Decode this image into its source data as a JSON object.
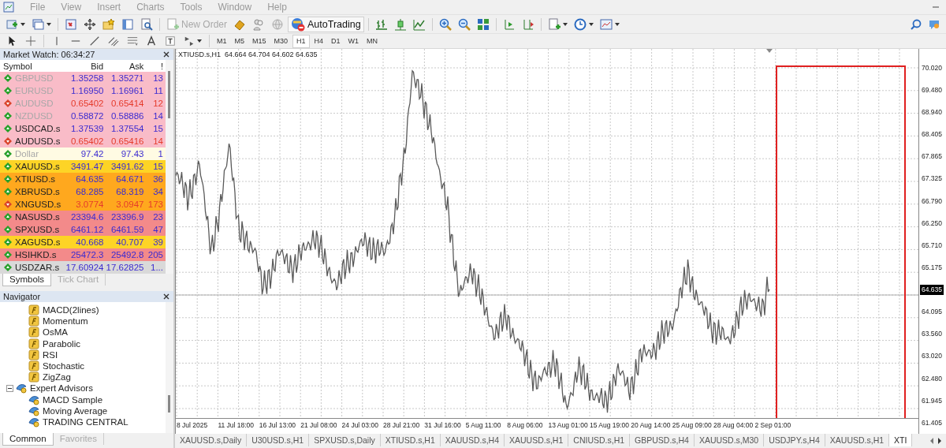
{
  "menu": [
    "File",
    "View",
    "Insert",
    "Charts",
    "Tools",
    "Window",
    "Help"
  ],
  "toolbar": {
    "new_order": {
      "label": "New Order",
      "disabled": true
    },
    "autotrading": {
      "label": "AutoTrading"
    }
  },
  "timeframes": [
    {
      "label": "M1",
      "selected": false
    },
    {
      "label": "M5",
      "selected": false
    },
    {
      "label": "M15",
      "selected": false
    },
    {
      "label": "M30",
      "selected": false
    },
    {
      "label": "H1",
      "selected": true
    },
    {
      "label": "H4",
      "selected": false
    },
    {
      "label": "D1",
      "selected": false
    },
    {
      "label": "W1",
      "selected": false
    },
    {
      "label": "MN",
      "selected": false
    }
  ],
  "market_watch": {
    "title": "Market Watch: 06:34:27",
    "columns": [
      "Symbol",
      "Bid",
      "Ask",
      "!"
    ],
    "rows": [
      {
        "symbol": "GBPUSD",
        "bid": "1.35258",
        "ask": "1.35271",
        "spread": "13",
        "down": false,
        "dimmed": true,
        "color": "#f9bcc8"
      },
      {
        "symbol": "EURUSD",
        "bid": "1.16950",
        "ask": "1.16961",
        "spread": "11",
        "down": false,
        "dimmed": true,
        "color": "#f9bcc8"
      },
      {
        "symbol": "AUDUSD",
        "bid": "0.65402",
        "ask": "0.65414",
        "spread": "12",
        "down": true,
        "dimmed": true,
        "color": "#f9bcc8"
      },
      {
        "symbol": "NZDUSD",
        "bid": "0.58872",
        "ask": "0.58886",
        "spread": "14",
        "down": false,
        "dimmed": true,
        "color": "#f9bcc8"
      },
      {
        "symbol": "USDCAD.s",
        "bid": "1.37539",
        "ask": "1.37554",
        "spread": "15",
        "down": false,
        "dimmed": false,
        "color": "#f9bcc8"
      },
      {
        "symbol": "AUDUSD.s",
        "bid": "0.65402",
        "ask": "0.65416",
        "spread": "14",
        "down": true,
        "dimmed": false,
        "color": "#f9bcc8"
      },
      {
        "symbol": "Dollar",
        "bid": "97.42",
        "ask": "97.43",
        "spread": "1",
        "down": false,
        "dimmed": true,
        "color": "#fffbe3"
      },
      {
        "symbol": "XAUUSD.s",
        "bid": "3491.47",
        "ask": "3491.62",
        "spread": "15",
        "down": false,
        "dimmed": false,
        "color": "#fdd426"
      },
      {
        "symbol": "XTIUSD.s",
        "bid": "64.635",
        "ask": "64.671",
        "spread": "36",
        "down": false,
        "dimmed": false,
        "color": "#ffa81e"
      },
      {
        "symbol": "XBRUSD.s",
        "bid": "68.285",
        "ask": "68.319",
        "spread": "34",
        "down": false,
        "dimmed": false,
        "color": "#ffa81e"
      },
      {
        "symbol": "XNGUSD.s",
        "bid": "3.0774",
        "ask": "3.0947",
        "spread": "173",
        "down": true,
        "dimmed": false,
        "color": "#ffa81e"
      },
      {
        "symbol": "NASUSD.s",
        "bid": "23394.6",
        "ask": "23396.9",
        "spread": "23",
        "down": false,
        "dimmed": false,
        "color": "#f38a8a"
      },
      {
        "symbol": "SPXUSD.s",
        "bid": "6461.12",
        "ask": "6461.59",
        "spread": "47",
        "down": false,
        "dimmed": false,
        "color": "#f38a8a"
      },
      {
        "symbol": "XAGUSD.s",
        "bid": "40.668",
        "ask": "40.707",
        "spread": "39",
        "down": false,
        "dimmed": false,
        "color": "#fdd426"
      },
      {
        "symbol": "HSIHKD.s",
        "bid": "25472.3",
        "ask": "25492.8",
        "spread": "205",
        "down": false,
        "dimmed": false,
        "color": "#f38a8a"
      },
      {
        "symbol": "USDZAR.s",
        "bid": "17.60924",
        "ask": "17.62825",
        "spread": "1...",
        "down": false,
        "dimmed": false,
        "color": "#d9d9d9"
      }
    ],
    "tabs": [
      {
        "label": "Symbols",
        "selected": true
      },
      {
        "label": "Tick Chart",
        "selected": false
      }
    ]
  },
  "navigator": {
    "title": "Navigator",
    "items": [
      {
        "label": "MACD(2lines)",
        "kind": "indicator"
      },
      {
        "label": "Momentum",
        "kind": "indicator"
      },
      {
        "label": "OsMA",
        "kind": "indicator"
      },
      {
        "label": "Parabolic",
        "kind": "indicator"
      },
      {
        "label": "RSI",
        "kind": "indicator"
      },
      {
        "label": "Stochastic",
        "kind": "indicator"
      },
      {
        "label": "ZigZag",
        "kind": "indicator"
      },
      {
        "label": "Expert Advisors",
        "kind": "folder",
        "expanded": true,
        "children": [
          {
            "label": "MACD Sample",
            "kind": "expert"
          },
          {
            "label": "Moving Average",
            "kind": "expert"
          },
          {
            "label": "TRADING CENTRAL",
            "kind": "expert"
          }
        ]
      }
    ],
    "tabs": [
      {
        "label": "Common",
        "selected": true
      },
      {
        "label": "Favorites",
        "selected": false
      }
    ]
  },
  "chart": {
    "header": "XTIUSD.s,H1  64.664 64.704 64.602 64.635",
    "price_labels": [
      {
        "label": "70.020",
        "current": false
      },
      {
        "label": "69.480",
        "current": false
      },
      {
        "label": "68.940",
        "current": false
      },
      {
        "label": "68.405",
        "current": false
      },
      {
        "label": "67.865",
        "current": false
      },
      {
        "label": "67.325",
        "current": false
      },
      {
        "label": "66.790",
        "current": false
      },
      {
        "label": "66.250",
        "current": false
      },
      {
        "label": "65.710",
        "current": false
      },
      {
        "label": "65.175",
        "current": false
      },
      {
        "label": "64.635",
        "current": true
      },
      {
        "label": "64.095",
        "current": false
      },
      {
        "label": "63.560",
        "current": false
      },
      {
        "label": "63.020",
        "current": false
      },
      {
        "label": "62.480",
        "current": false
      },
      {
        "label": "61.945",
        "current": false
      },
      {
        "label": "61.405",
        "current": false
      }
    ],
    "time_labels": [
      "8 Jul 2025",
      "11 Jul 18:00",
      "16 Jul 13:00",
      "21 Jul 08:00",
      "24 Jul 03:00",
      "28 Jul 21:00",
      "31 Jul 16:00",
      "5 Aug 11:00",
      "8 Aug 06:00",
      "13 Aug 01:00",
      "15 Aug 19:00",
      "20 Aug 14:00",
      "25 Aug 09:00",
      "28 Aug 04:00",
      "2 Sep 01:00"
    ]
  },
  "chart_tabs": [
    {
      "label": "XAUUSD.s,Daily",
      "selected": false
    },
    {
      "label": "U30USD.s,H1",
      "selected": false
    },
    {
      "label": "SPXUSD.s,Daily",
      "selected": false
    },
    {
      "label": "XTIUSD.s,H1",
      "selected": false
    },
    {
      "label": "XAUUSD.s,H4",
      "selected": false
    },
    {
      "label": "XAUUSD.s,H1",
      "selected": false
    },
    {
      "label": "CNIUSD.s,H1",
      "selected": false
    },
    {
      "label": "GBPUSD.s,H4",
      "selected": false
    },
    {
      "label": "XAUUSD.s,M30",
      "selected": false
    },
    {
      "label": "USDJPY.s,H4",
      "selected": false
    },
    {
      "label": "XAUUSD.s,H1",
      "selected": false
    },
    {
      "label": "XTI",
      "selected": true
    }
  ]
}
